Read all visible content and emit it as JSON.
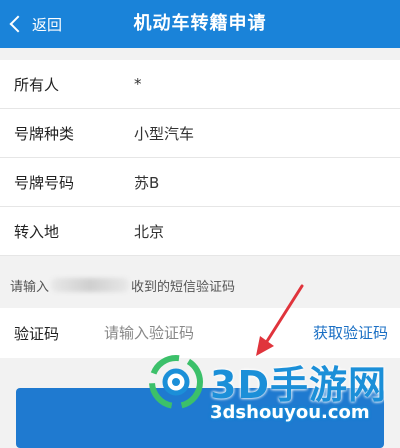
{
  "navbar": {
    "back_label": "返回",
    "title": "机动车转籍申请"
  },
  "form": {
    "rows": [
      {
        "label": "所有人",
        "value": "*"
      },
      {
        "label": "号牌种类",
        "value": "小型汽车"
      },
      {
        "label": "号牌号码",
        "value": "苏B"
      },
      {
        "label": "转入地",
        "value": "北京"
      }
    ]
  },
  "sms_hint": {
    "prefix": "请输入",
    "suffix": "收到的短信验证码"
  },
  "verify": {
    "label": "验证码",
    "placeholder": "请输入验证码",
    "get_code_label": "获取验证码"
  },
  "watermark": {
    "title": "3D手游网",
    "url": "3dshouyou.com"
  },
  "colors": {
    "brand": "#1a83d9",
    "link": "#1a6fc4",
    "arrow": "#e0343c"
  }
}
